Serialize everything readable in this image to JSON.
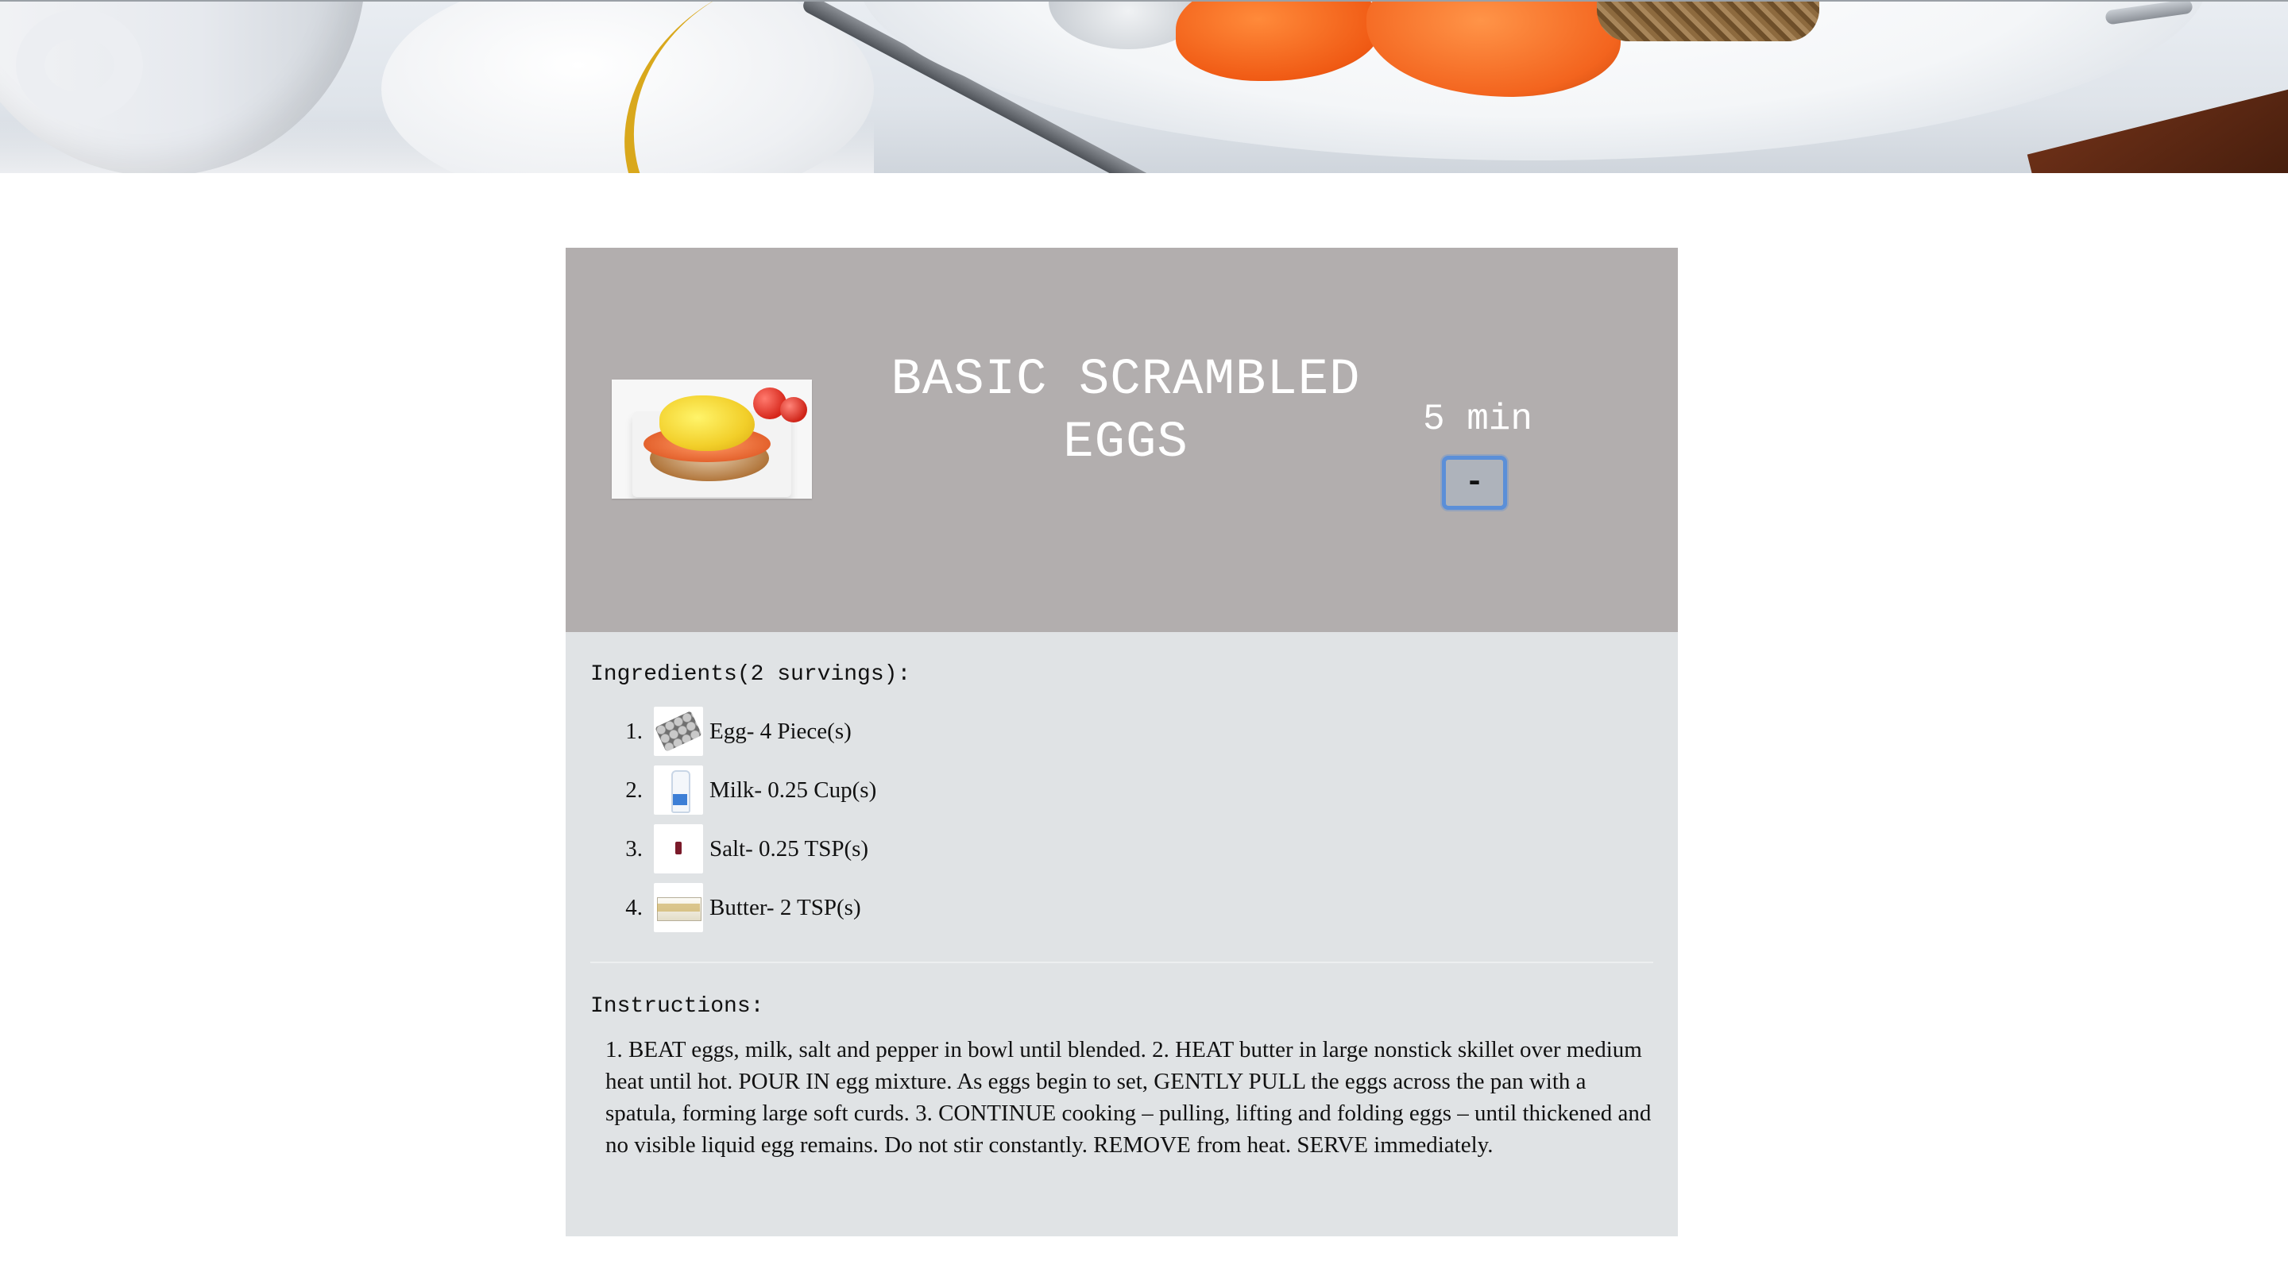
{
  "recipe": {
    "title": "BASIC SCRAMBLED EGGS",
    "time": "5 min",
    "toggle_label": "-",
    "ingredients_heading": "Ingredients(2 survings):",
    "ingredients": [
      {
        "number": "1.",
        "text": "Egg- 4 Piece(s)",
        "icon": "egg-carton-icon"
      },
      {
        "number": "2.",
        "text": "Milk- 0.25 Cup(s)",
        "icon": "milk-bottle-icon"
      },
      {
        "number": "3.",
        "text": "Salt- 0.25 TSP(s)",
        "icon": "salt-icon"
      },
      {
        "number": "4.",
        "text": "Butter- 2 TSP(s)",
        "icon": "butter-icon"
      }
    ],
    "instructions_heading": "Instructions:",
    "instructions": "1. BEAT eggs, milk, salt and pepper in bowl until blended. 2. HEAT butter in large nonstick skillet over medium heat until hot. POUR IN egg mixture. As eggs begin to set, GENTLY PULL the eggs across the pan with a spatula, forming large soft curds. 3. CONTINUE cooking – pulling, lifting and folding eggs – until thickened and no visible liquid egg remains. Do not stir constantly. REMOVE from heat. SERVE immediately."
  },
  "colors": {
    "header_bg": "#b2aeae",
    "card_bg": "#e0e3e5",
    "button_focus": "#5b8fd8"
  }
}
